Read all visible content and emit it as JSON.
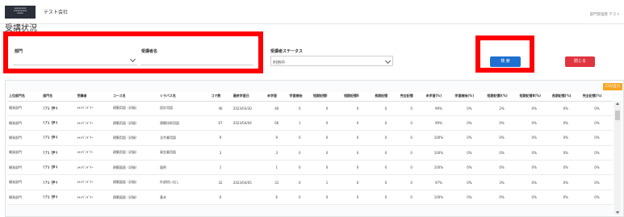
{
  "header": {
    "logo_lines": [
      "xxxxxxxxxx",
      "xxxxxxxxxxx",
      "xxxxx"
    ],
    "company": "テスト会社",
    "role": "部門管理者 テスト"
  },
  "page_title": "受講状況",
  "filters": {
    "dept_label": "部門",
    "dept_value": "",
    "learner_label": "受講者名",
    "learner_value": "",
    "status_label": "受講者ステータス",
    "status_value": "利用中",
    "search_button": "検 索",
    "close_button": "閉じる"
  },
  "table": {
    "csv_button": "CSV出力",
    "headers": [
      "上位部門名",
      "部門名",
      "受講者",
      "コース名",
      "シラバス名",
      "コマ数",
      "最終学習日",
      "未学習",
      "学習開始",
      "短期記憶Ⅰ",
      "短期記憶Ⅱ",
      "長期記憶",
      "完全記憶",
      "未学習(%)",
      "学習開始(%)",
      "短期記憶Ⅰ(%)",
      "短期記憶Ⅱ(%)",
      "長期記憶(%)",
      "完全記憶(%)"
    ],
    "rows": [
      [
        "開発部門",
        "ﾘｱﾙ 伊ｷ",
        "ｼｬﾝﾊﾟﾝﾄﾞﾘｰ",
        "建築用語（初級）",
        "設計用語",
        "46",
        "2023/03/30",
        "46",
        "0",
        "0",
        "0",
        "0",
        "0",
        "99%",
        "0%",
        "2%",
        "0%",
        "0%",
        "0%"
      ],
      [
        "開発部門",
        "ﾘｱﾙ 伊ｷ",
        "ｼｬﾝﾊﾟﾝﾄﾞﾘｰ",
        "建築用語（初級）",
        "建築技術用語",
        "67",
        "2023/04/04",
        "66",
        "1",
        "0",
        "0",
        "0",
        "0",
        "99%",
        "0%",
        "0%",
        "0%",
        "0%",
        "0%"
      ],
      [
        "開発部門",
        "ﾘｱﾙ 伊ｷ",
        "ｼｬﾝﾊﾟﾝﾄﾞﾘｰ",
        "建築用語（初級）",
        "法令業用語",
        "9",
        "",
        "9",
        "0",
        "0",
        "0",
        "0",
        "0",
        "100%",
        "0%",
        "0%",
        "0%",
        "0%",
        "0%"
      ],
      [
        "開発部門",
        "ﾘｱﾙ 伊ｷ",
        "ｼｬﾝﾊﾟﾝﾄﾞﾘｰ",
        "建築用語（初級）",
        "資金業用語",
        "3",
        "",
        "3",
        "0",
        "0",
        "0",
        "0",
        "0",
        "100%",
        "0%",
        "0%",
        "0%",
        "0%",
        "0%"
      ],
      [
        "開発部門",
        "ﾘｱﾙ 伊ｷ",
        "ｼｬﾝﾊﾟﾝﾄﾞﾘｰ",
        "建築図面（初級）",
        "図例",
        "1",
        "",
        "1",
        "0",
        "0",
        "0",
        "0",
        "0",
        "100%",
        "0%",
        "0%",
        "0%",
        "0%",
        "0%"
      ],
      [
        "開発部門",
        "ﾘｱﾙ 伊ｷ",
        "ｼｬﾝﾊﾟﾝﾄﾞﾘｰ",
        "建築図面（初級）",
        "外部拾い出し",
        "32",
        "2023/04/05",
        "31",
        "0",
        "1",
        "0",
        "0",
        "0",
        "97%",
        "0%",
        "3%",
        "0%",
        "0%",
        "0%"
      ],
      [
        "開発部門",
        "ﾘｱﾙ 伊ｷ",
        "ｼｬﾝﾊﾟﾝﾄﾞﾘｰ",
        "建築図面（初級）",
        "基本",
        "6",
        "",
        "6",
        "0",
        "0",
        "0",
        "0",
        "0",
        "100%",
        "0%",
        "0%",
        "0%",
        "0%",
        "0%"
      ]
    ]
  }
}
